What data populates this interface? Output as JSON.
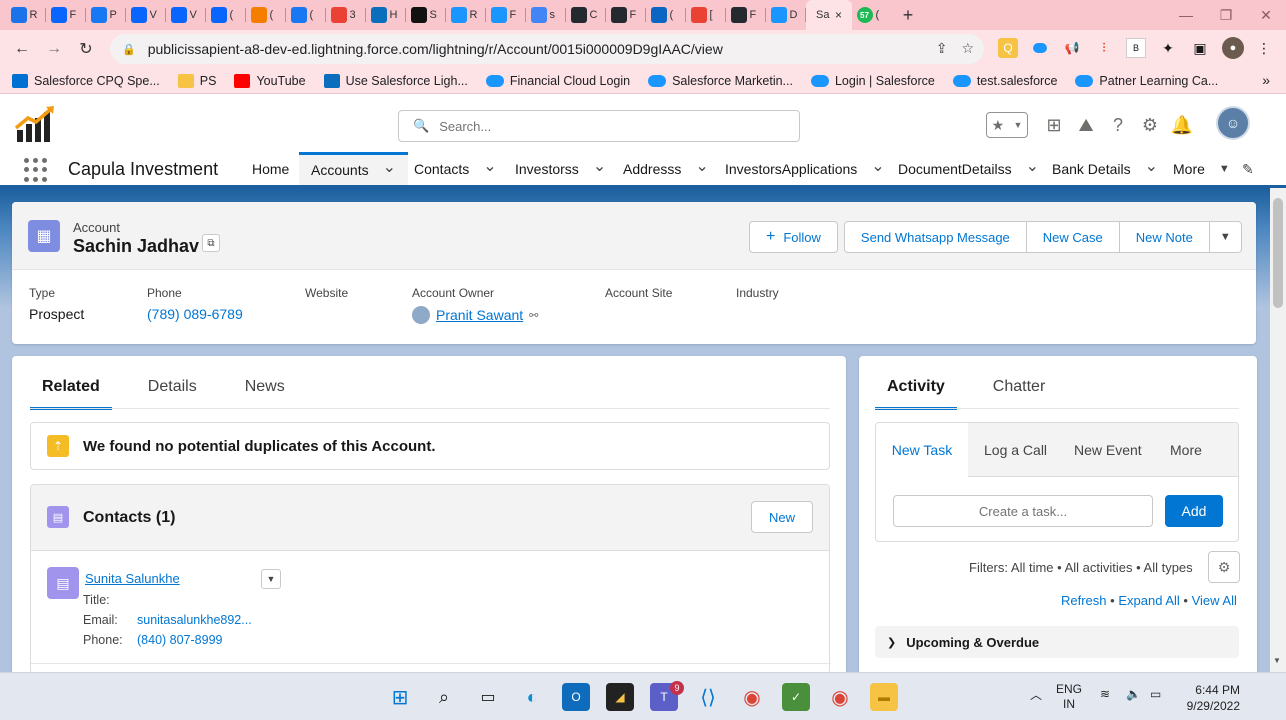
{
  "browser": {
    "tabs": [
      {
        "letter": "R",
        "icon": "diamond-icon",
        "color": "#1a73e8"
      },
      {
        "letter": "F",
        "icon": "meta-icon",
        "color": "#0866ff"
      },
      {
        "letter": "P",
        "icon": "facebook-icon",
        "color": "#1877f2"
      },
      {
        "letter": "V",
        "icon": "meta-icon",
        "color": "#0866ff"
      },
      {
        "letter": "V",
        "icon": "meta-icon",
        "color": "#0866ff"
      },
      {
        "letter": "(",
        "icon": "meta-icon",
        "color": "#0866ff"
      },
      {
        "letter": "(",
        "icon": "blogger-icon",
        "color": "#f57d00"
      },
      {
        "letter": "(",
        "icon": "facebook-icon",
        "color": "#1877f2"
      },
      {
        "letter": "3",
        "icon": "gmail-icon",
        "color": "#ea4335"
      },
      {
        "letter": "H",
        "icon": "ft-icon",
        "color": "#0a6ebd"
      },
      {
        "letter": "S",
        "icon": "wwe-icon",
        "color": "#111111"
      },
      {
        "letter": "R",
        "icon": "salesforce-cloud-icon",
        "color": "#1b96ff"
      },
      {
        "letter": "F",
        "icon": "salesforce-cloud-icon",
        "color": "#1b96ff"
      },
      {
        "letter": "s",
        "icon": "google-icon",
        "color": "#4285f4"
      },
      {
        "letter": "C",
        "icon": "github-icon",
        "color": "#24292f"
      },
      {
        "letter": "F",
        "icon": "github-icon",
        "color": "#24292f"
      },
      {
        "letter": "(",
        "icon": "linkedin-icon",
        "color": "#0a66c2"
      },
      {
        "letter": "[",
        "icon": "gmail-icon",
        "color": "#ea4335"
      },
      {
        "letter": "F",
        "icon": "github-icon",
        "color": "#24292f"
      },
      {
        "letter": "D",
        "icon": "salesforce-cloud-icon",
        "color": "#1b96ff"
      }
    ],
    "active_tab": {
      "letter": "Sa",
      "close": "×"
    },
    "last_tab": {
      "letter": "(",
      "badge": "57"
    },
    "new_tab": "+",
    "url": "publicissapient-a8-dev-ed.lightning.force.com/lightning/r/Account/0015i000009D9gIAAC/view",
    "bookmarks": [
      {
        "label": "Salesforce CPQ Spe...",
        "icon": "lsf-icon",
        "color": "#0070d2"
      },
      {
        "label": "PS",
        "icon": "folder-icon",
        "color": "#f6c344"
      },
      {
        "label": "YouTube",
        "icon": "youtube-icon",
        "color": "#ff0000"
      },
      {
        "label": "Use Salesforce Ligh...",
        "icon": "ft-icon",
        "color": "#0a6ebd"
      },
      {
        "label": "Financial Cloud Login",
        "icon": "salesforce-cloud-icon",
        "color": "#1b96ff"
      },
      {
        "label": "Salesforce Marketin...",
        "icon": "salesforce-cloud-icon",
        "color": "#1b96ff"
      },
      {
        "label": "Login | Salesforce",
        "icon": "salesforce-cloud-icon",
        "color": "#1b96ff"
      },
      {
        "label": "test.salesforce",
        "icon": "salesforce-cloud-icon",
        "color": "#1b96ff"
      },
      {
        "label": "Patner Learning Ca...",
        "icon": "salesforce-cloud-icon",
        "color": "#1b96ff"
      }
    ],
    "bookmarks_more": "»"
  },
  "sf": {
    "search_placeholder": "Search...",
    "app_name": "Capula Investment",
    "nav": [
      {
        "label": "Home",
        "chevron": false,
        "active": false
      },
      {
        "label": "Accounts",
        "chevron": true,
        "active": true
      },
      {
        "label": "Contacts",
        "chevron": true,
        "active": false
      },
      {
        "label": "Investorss",
        "chevron": true,
        "active": false
      },
      {
        "label": "Addresss",
        "chevron": true,
        "active": false
      },
      {
        "label": "InvestorsApplications",
        "chevron": true,
        "active": false
      },
      {
        "label": "DocumentDetailss",
        "chevron": true,
        "active": false
      },
      {
        "label": "Bank Details",
        "chevron": true,
        "active": false
      },
      {
        "label": "More",
        "chevron": true,
        "active": false
      }
    ]
  },
  "record": {
    "object_label": "Account",
    "name": "Sachin Jadhav",
    "actions": {
      "follow": "Follow",
      "whatsapp": "Send Whatsapp Message",
      "new_case": "New Case",
      "new_note": "New Note"
    },
    "fields": {
      "type_label": "Type",
      "type_value": "Prospect",
      "phone_label": "Phone",
      "phone_value": "(789) 089-6789",
      "website_label": "Website",
      "owner_label": "Account Owner",
      "owner_value": "Pranit Sawant",
      "site_label": "Account Site",
      "industry_label": "Industry"
    }
  },
  "related": {
    "tabs": [
      "Related",
      "Details",
      "News"
    ],
    "duplicates_msg": "We found no potential duplicates of this Account.",
    "contacts_title": "Contacts (1)",
    "new_label": "New",
    "contact": {
      "name": "Sunita Salunkhe",
      "title_label": "Title:",
      "email_label": "Email:",
      "email_value": "sunitasalunkhe892...",
      "phone_label": "Phone:",
      "phone_value": "(840) 807-8999"
    }
  },
  "activity": {
    "tabs": [
      "Activity",
      "Chatter"
    ],
    "composer_tabs": [
      "New Task",
      "Log a Call",
      "New Event",
      "More"
    ],
    "task_placeholder": "Create a task...",
    "add_label": "Add",
    "filters": "Filters: All time • All activities • All types",
    "refresh": "Refresh",
    "expand_all": "Expand All",
    "view_all": "View All",
    "bullet": "•",
    "upcoming": "Upcoming & Overdue"
  },
  "taskbar": {
    "lang_top": "ENG",
    "lang_bottom": "IN",
    "time": "6:44 PM",
    "date": "9/29/2022",
    "teams_badge": "9"
  }
}
